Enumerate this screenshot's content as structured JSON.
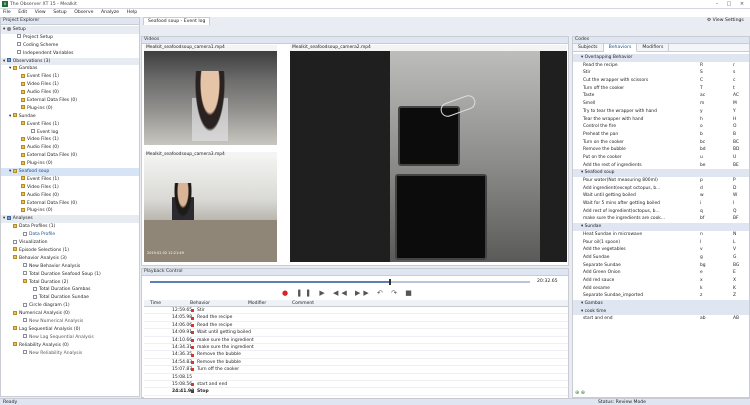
{
  "titlebar": {
    "title": "The Observer XT 15 - Mealkit"
  },
  "menu": [
    "File",
    "Edit",
    "View",
    "Setup",
    "Observe",
    "Analyze",
    "Help"
  ],
  "toolbar": {
    "view_settings": "View Settings"
  },
  "explorer": {
    "title": "Project Explorer",
    "setup": {
      "label": "Setup",
      "items": [
        "Project Setup",
        "Coding Scheme",
        "Independent Variables"
      ]
    },
    "observations": {
      "label": "Observations (3)"
    },
    "gambas": {
      "label": "Gambas",
      "items": [
        "Event Files (1)",
        "Video Files (1)",
        "Audio Files (0)",
        "External Data Files (0)",
        "Plug-ins (0)"
      ]
    },
    "sundae": {
      "label": "Sundae",
      "items": [
        "Event Files (1)",
        "Event log",
        "Video Files (1)",
        "Audio Files (0)",
        "External Data Files (0)",
        "Plug-ins (0)"
      ]
    },
    "seafood": {
      "label": "Seafood soup",
      "items": [
        "Event Files (1)",
        "Video Files (1)",
        "Audio Files (0)",
        "External Data Files (0)",
        "Plug-ins (0)"
      ]
    },
    "analyses": {
      "label": "Analyses"
    },
    "analysis_items": [
      "Data Profiles (1)",
      "Data Profile",
      "Visualization",
      "Episode Selections (1)",
      "Behavior Analysis (3)",
      "New Behavior Analysis",
      "Total Duration Seafood Soup (1)",
      "Total Duration (2)",
      "Total Duration Gambas",
      "Total Duration Sundae",
      "Circle diagram (1)",
      "Numerical Analysis (0)",
      "New Numerical Analysis",
      "Lag Sequential Analysis (0)",
      "New Lag Sequential Analysis",
      "Reliability Analysis (0)",
      "New Reliability Analysis"
    ]
  },
  "doc_tab": "Seafood soup - Event log",
  "videos": {
    "title": "Videos",
    "cam1": "Mealkit_seafoodsoup_camera1.mp4",
    "cam2": "Mealkit_seafoodsoup_camera2.mp4",
    "cam3": "Mealkit_seafoodsoup_camera3.mp4"
  },
  "playback": {
    "title": "Playback Control",
    "time": "20:32.65",
    "progress": 0.63
  },
  "log": {
    "headers": [
      "Time",
      "Behavior",
      "Modifier",
      "Comment"
    ],
    "rows": [
      {
        "time": "12:59.65",
        "behavior": "Stir"
      },
      {
        "time": "14:05.98",
        "behavior": "Read the recipe"
      },
      {
        "time": "14:06.06",
        "behavior": "Read the recipe"
      },
      {
        "time": "14:09.91",
        "behavior": "Wait until getting boiled"
      },
      {
        "time": "14:10.66",
        "behavior": "make sure the ingredient"
      },
      {
        "time": "14:34.31",
        "behavior": "make sure the ingredient"
      },
      {
        "time": "14:36.35",
        "behavior": "Remove the bubble"
      },
      {
        "time": "14:54.83",
        "behavior": "Remove the bubble"
      },
      {
        "time": "15:07.87",
        "behavior": "Turn off the cooker"
      },
      {
        "time": "15:08.15",
        "behavior": ""
      },
      {
        "time": "15:08.56",
        "behavior": "start and end"
      },
      {
        "time": "24:41.90",
        "behavior": "Stop"
      }
    ]
  },
  "codes": {
    "title": "Codes",
    "tabs": [
      "Subjects",
      "Behaviors",
      "Modifiers"
    ],
    "rows": [
      {
        "type": "sec",
        "name": "Overlapping Behavior"
      },
      {
        "name": "Read the recipe",
        "k1": "R",
        "k2": "r"
      },
      {
        "name": "Stir",
        "k1": "S",
        "k2": "s"
      },
      {
        "name": "Cut the wrapper with scissors",
        "k1": "C",
        "k2": "c"
      },
      {
        "name": "Turn off the cooker",
        "k1": "T",
        "k2": "t"
      },
      {
        "name": "Taste",
        "k1": "ac",
        "k2": "AC"
      },
      {
        "name": "Smell",
        "k1": "m",
        "k2": "M"
      },
      {
        "name": "Try to tear the wrapper with hand",
        "k1": "y",
        "k2": "Y"
      },
      {
        "name": "Tear the wrapper with hand",
        "k1": "h",
        "k2": "H"
      },
      {
        "name": "Control the fire",
        "k1": "o",
        "k2": "O"
      },
      {
        "name": "Preheat the pan",
        "k1": "b",
        "k2": "B"
      },
      {
        "name": "Turn on the cooker",
        "k1": "bc",
        "k2": "BC"
      },
      {
        "name": "Remove the bubble",
        "k1": "bd",
        "k2": "BD"
      },
      {
        "name": "Put on the cooker",
        "k1": "u",
        "k2": "U"
      },
      {
        "name": "Add the rest of ingredients",
        "k1": "be",
        "k2": "BE"
      },
      {
        "type": "sec",
        "name": "Seafood soup"
      },
      {
        "name": "Pour water(Not measuring 800ml)",
        "k1": "p",
        "k2": "P"
      },
      {
        "name": "Add ingredient(except octopus, b...",
        "k1": "d",
        "k2": "D"
      },
      {
        "name": "Wait until getting boiled",
        "k1": "w",
        "k2": "W"
      },
      {
        "name": "Wait for 5 mins after getting boiled",
        "k1": "i",
        "k2": "I"
      },
      {
        "name": "Add rest of ingredient(octopus, b...",
        "k1": "q",
        "k2": "Q"
      },
      {
        "name": "make sure the ingredients are cook...",
        "k1": "bf",
        "k2": "BF"
      },
      {
        "type": "sec",
        "name": "Sundae"
      },
      {
        "name": "Heat Sundae in microwave",
        "k1": "n",
        "k2": "N"
      },
      {
        "name": "Pour oil(1 spoon)",
        "k1": "l",
        "k2": "L"
      },
      {
        "name": "Add the vegetables",
        "k1": "v",
        "k2": "V"
      },
      {
        "name": "Add Sundae",
        "k1": "g",
        "k2": "G"
      },
      {
        "name": "Separate Sundae",
        "k1": "bg",
        "k2": "BG"
      },
      {
        "name": "Add Green Onion",
        "k1": "e",
        "k2": "E"
      },
      {
        "name": "Add red sauce",
        "k1": "x",
        "k2": "X"
      },
      {
        "name": "Add sesame",
        "k1": "k",
        "k2": "K"
      },
      {
        "name": "Separate Sundae_imported",
        "k1": "z",
        "k2": "Z"
      },
      {
        "type": "sec",
        "name": "Gambas"
      },
      {
        "type": "sec",
        "name": "cook time"
      },
      {
        "name": "start and end",
        "k1": "ab",
        "k2": "AB"
      }
    ]
  },
  "status": {
    "left": "Ready",
    "right": "Status: Review Mode"
  }
}
